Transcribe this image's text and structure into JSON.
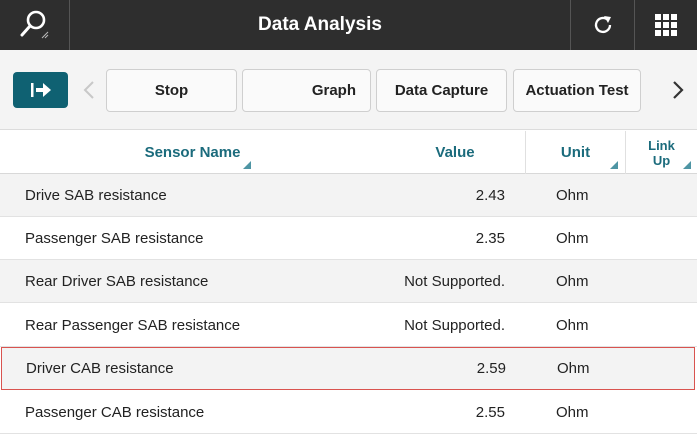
{
  "header": {
    "title": "Data Analysis"
  },
  "toolbar": {
    "buttons": [
      {
        "label": "Stop"
      },
      {
        "label": "Graph"
      },
      {
        "label": "Data Capture"
      },
      {
        "label": "Actuation Test"
      }
    ]
  },
  "table": {
    "columns": {
      "name": "Sensor Name",
      "value": "Value",
      "unit": "Unit",
      "link_line1": "Link",
      "link_line2": "Up"
    },
    "rows": [
      {
        "name": "Drive SAB resistance",
        "value": "2.43",
        "unit": "Ohm"
      },
      {
        "name": "Passenger SAB resistance",
        "value": "2.35",
        "unit": "Ohm"
      },
      {
        "name": "Rear Driver SAB resistance",
        "value": "Not Supported.",
        "unit": "Ohm"
      },
      {
        "name": "Rear Passenger SAB resistance",
        "value": "Not Supported.",
        "unit": "Ohm"
      },
      {
        "name": "Driver CAB resistance",
        "value": "2.59",
        "unit": "Ohm"
      },
      {
        "name": "Passenger CAB resistance",
        "value": "2.55",
        "unit": "Ohm"
      }
    ]
  },
  "colors": {
    "topbar": "#2e2e2e",
    "accent": "#0f6172",
    "header_text": "#1b6b7c",
    "selection": "#d9534f"
  }
}
